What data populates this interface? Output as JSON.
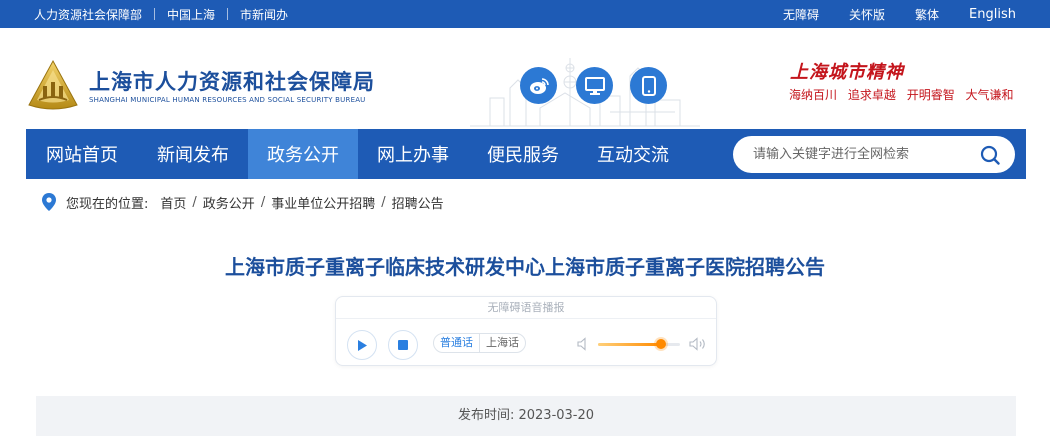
{
  "topbar": {
    "left_links": [
      "人力资源社会保障部",
      "中国上海",
      "市新闻办"
    ],
    "right_links": [
      "无障碍",
      "关怀版",
      "繁体"
    ],
    "english_label": "English"
  },
  "header": {
    "site_title": "上海市人力资源和社会保障局",
    "site_subtitle": "SHANGHAI MUNICIPAL HUMAN RESOURCES AND SOCIAL SECURITY BUREAU",
    "social_icons": [
      "weibo-icon",
      "computer-icon",
      "mobile-icon"
    ],
    "spirit_title": "上海城市精神",
    "spirit_words": [
      "海纳百川",
      "追求卓越",
      "开明睿智",
      "大气谦和"
    ]
  },
  "nav": {
    "items": [
      {
        "label": "网站首页",
        "active": false
      },
      {
        "label": "新闻发布",
        "active": false
      },
      {
        "label": "政务公开",
        "active": true
      },
      {
        "label": "网上办事",
        "active": false
      },
      {
        "label": "便民服务",
        "active": false
      },
      {
        "label": "互动交流",
        "active": false
      }
    ],
    "search_placeholder": "请输入关键字进行全网检索"
  },
  "breadcrumb": {
    "label": "您现在的位置:",
    "items": [
      "首页",
      "政务公开",
      "事业单位公开招聘",
      "招聘公告"
    ]
  },
  "article": {
    "title": "上海市质子重离子临床技术研发中心上海市质子重离子医院招聘公告",
    "publish_label": "发布时间:",
    "publish_date": "2023-03-20"
  },
  "player": {
    "caption": "无障碍语音播报",
    "dialects": [
      "普通话",
      "上海话"
    ],
    "selected_dialect": "普通话",
    "volume_level": 0.77
  },
  "colors": {
    "brand_blue": "#1e5bb5",
    "nav_active": "#3f84d8",
    "title_blue": "#1c4f9c",
    "spirit_red": "#c4151c",
    "volume_orange": "#ff8a00"
  }
}
